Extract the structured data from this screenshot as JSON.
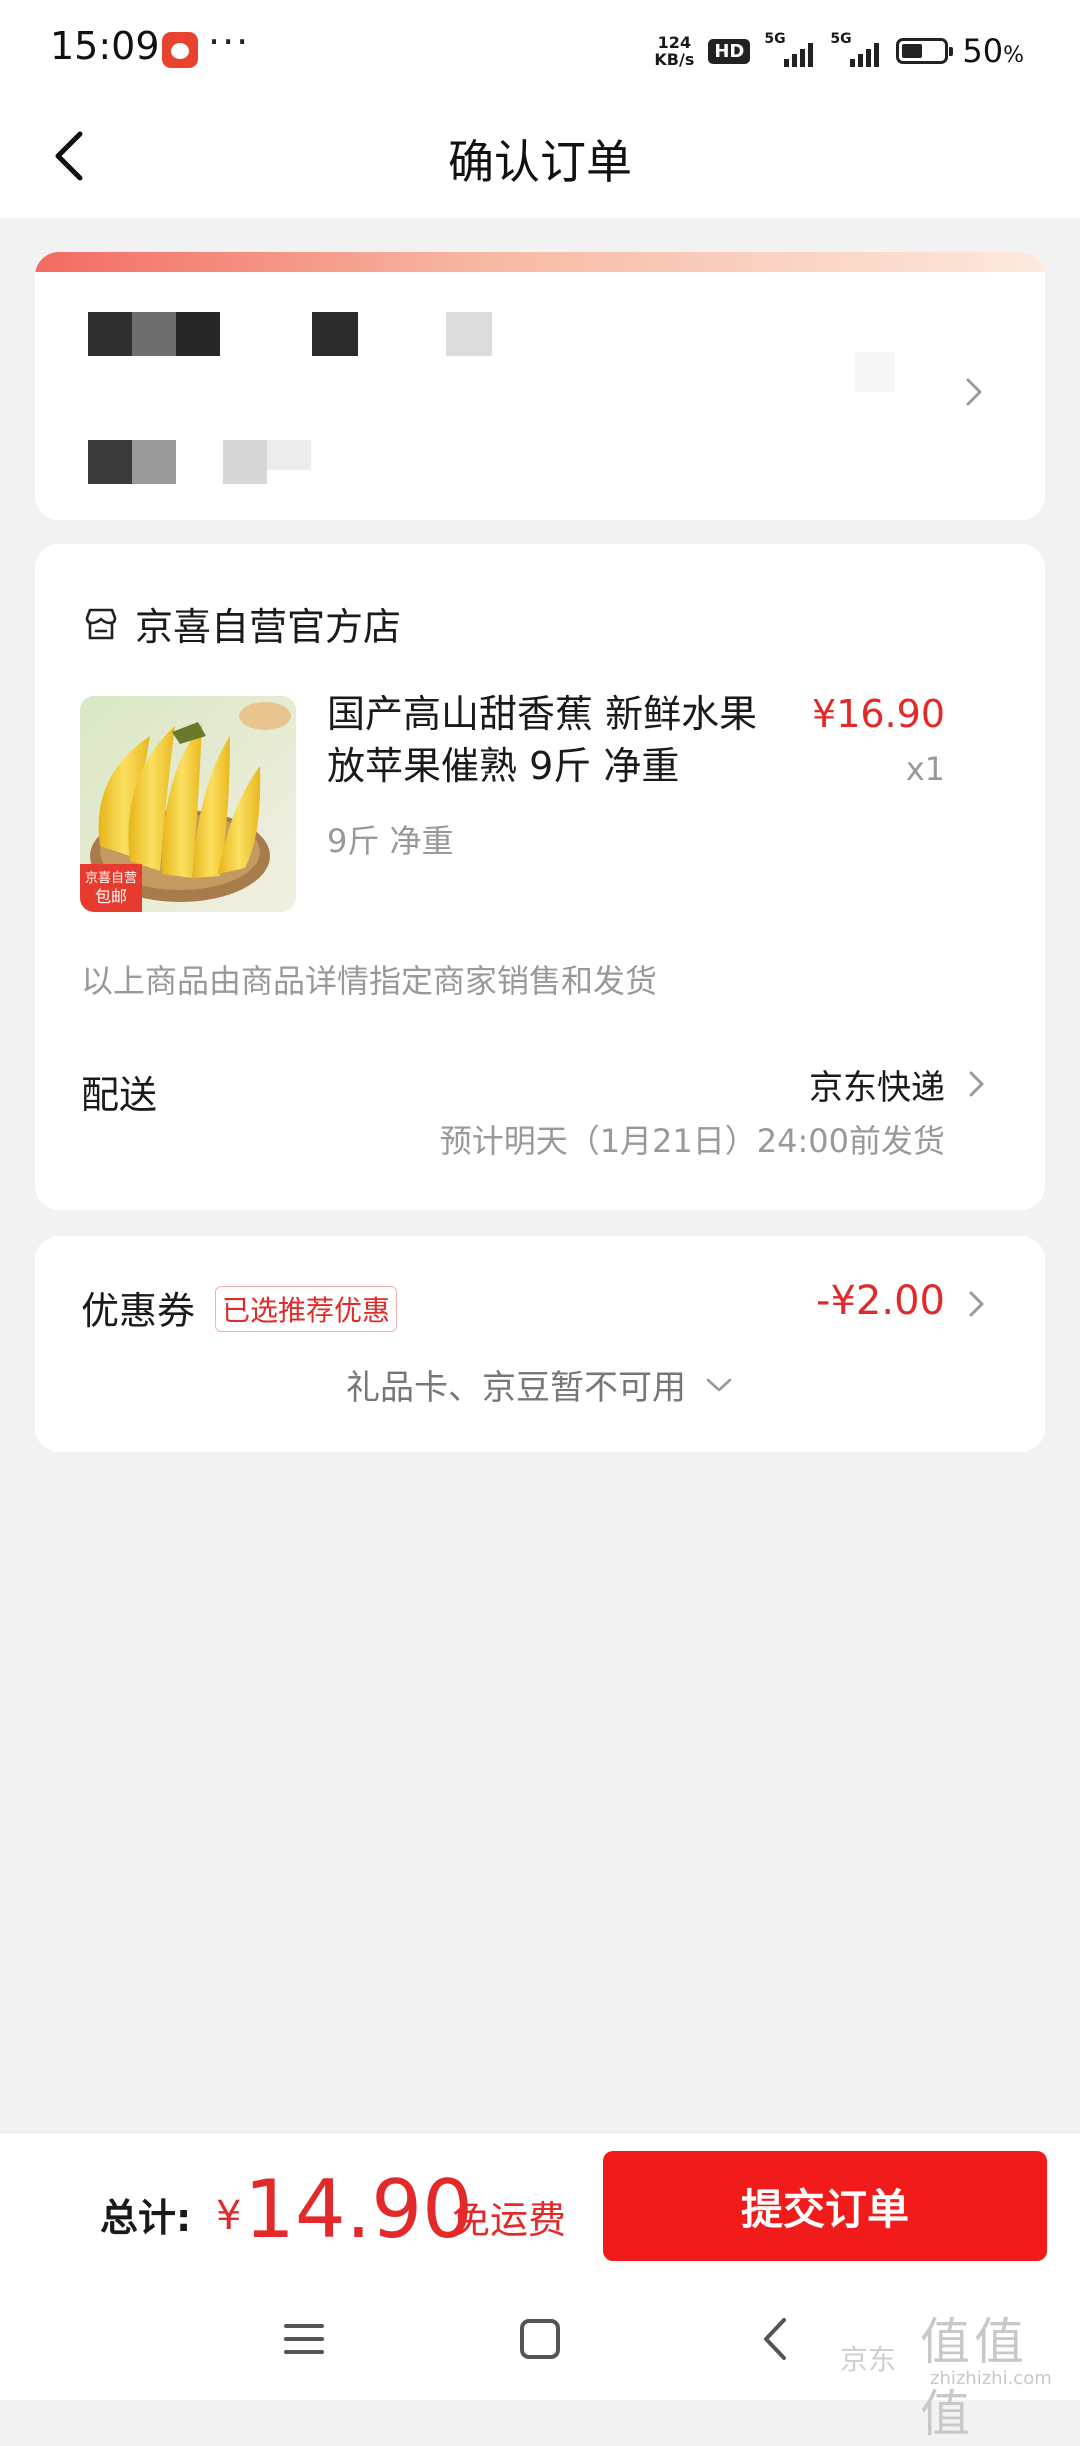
{
  "status_bar": {
    "time": "15:09",
    "more": "···",
    "speed_top": "124",
    "speed_bottom": "KB/s",
    "hd": "HD",
    "net_tag_1": "5G",
    "net_tag_2": "5G",
    "battery_percent": "50",
    "battery_unit": "%"
  },
  "header": {
    "title": "确认订单"
  },
  "shop": {
    "name": "京喜自营官方店"
  },
  "product": {
    "title": "国产高山甜香蕉 新鲜水果 放苹果催熟 9斤 净重",
    "price": "¥16.90",
    "quantity": "x1",
    "spec": "9斤 净重",
    "badge_line1": "京喜自营",
    "badge_line2": "包邮"
  },
  "seller_note": "以上商品由商品详情指定商家销售和发货",
  "delivery": {
    "label": "配送",
    "value": "京东快递",
    "estimate": "预计明天（1月21日）24:00前发货"
  },
  "coupon": {
    "label": "优惠券",
    "tag": "已选推荐优惠",
    "value": "-¥2.00",
    "unavailable": "礼品卡、京豆暂不可用"
  },
  "footer": {
    "total_label": "总计:",
    "currency": "¥",
    "total_amount": "14.90",
    "free_shipping": "免运费",
    "submit_label": "提交订单"
  },
  "watermark": {
    "text": "京东",
    "logo": "值值值",
    "site": "zhizhizhi.com"
  },
  "colors": {
    "accent": "#e22a2a",
    "submit_button": "#f21b1b",
    "background": "#f2f2f2"
  },
  "icons": [
    "back-arrow-icon",
    "store-icon",
    "chevron-right-icon",
    "chevron-down-icon",
    "menu-icon",
    "home-icon",
    "back-icon"
  ]
}
